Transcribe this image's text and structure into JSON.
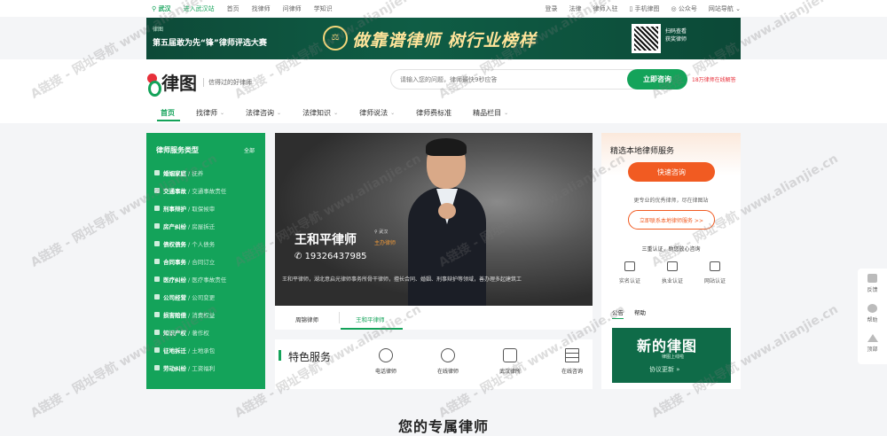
{
  "topbar": {
    "city": "武汉",
    "enter_site": "进入武汉站",
    "left_links": [
      "首页",
      "找律师",
      "问律师",
      "学知识"
    ],
    "right_links": [
      "登录",
      "法律",
      "律师入驻",
      "手机律图",
      "公众号",
      "网站导航"
    ]
  },
  "banner": {
    "brand": "律图",
    "subtitle": "第五届敢为先“锋”律师评选大赛",
    "slogan": "做靠谱律师 树行业榜样",
    "qr_text": [
      "扫码查看",
      "获奖律师"
    ]
  },
  "header": {
    "logo_name": "律图",
    "tagline": "信得过的好律师",
    "search_placeholder": "请输入您的问题，律师最快9秒应答",
    "consult_button": "立即咨询",
    "hotline": "18万律师在线解答"
  },
  "nav": {
    "items": [
      "首页",
      "找律师",
      "法律咨询",
      "法律知识",
      "律师说法",
      "律师费标准",
      "精品栏目"
    ]
  },
  "sidebar": {
    "title": "律师服务类型",
    "all_label": "全部",
    "items": [
      {
        "cat": "婚姻家庭",
        "sub": "/ 抚养"
      },
      {
        "cat": "交通事故",
        "sub": "/ 交通事故责任"
      },
      {
        "cat": "刑事辩护",
        "sub": "/ 取保候审"
      },
      {
        "cat": "房产纠纷",
        "sub": "/ 房屋拆迁"
      },
      {
        "cat": "债权债务",
        "sub": "/ 个人债务"
      },
      {
        "cat": "合同事务",
        "sub": "/ 合同订立"
      },
      {
        "cat": "医疗纠纷",
        "sub": "/ 医疗事故责任"
      },
      {
        "cat": "公司经营",
        "sub": "/ 公司变更"
      },
      {
        "cat": "损害赔偿",
        "sub": "/ 消费权益"
      },
      {
        "cat": "知识产权",
        "sub": "/ 著作权"
      },
      {
        "cat": "征地拆迁",
        "sub": "/ 土地承包"
      },
      {
        "cat": "劳动纠纷",
        "sub": "/ 工资福利"
      }
    ]
  },
  "feature": {
    "lawyer_name": "王和平律师",
    "location": "武汉",
    "role": "主办律师",
    "phone": "19326437985",
    "description": "王和平律师，湖北意启光律师事务所骨干律师，擅长合同、婚姻、刑事辩护等领域，善办理多起建筑工"
  },
  "lawyer_tabs": [
    "周锦律师",
    "王和平律师"
  ],
  "services": {
    "title": "特色服务",
    "items": [
      "电话律师",
      "在线律师",
      "武汉律所",
      "在线咨询"
    ]
  },
  "right_panel": {
    "title": "精选本地律师服务",
    "quick_button": "快速咨询",
    "note": "更专业的优秀律师，尽在律图站",
    "join_button": "立即联系本地律师服务 >>",
    "triple_check": "三重认证，助您放心咨询",
    "badges": [
      "实名认证",
      "执业认证",
      "网站认证"
    ],
    "tabs": [
      "公告",
      "帮助"
    ],
    "promo_title": "新的律图",
    "promo_sub": "律图上线啦",
    "promo_link": "协议更新 »"
  },
  "float_bar": [
    "反馈",
    "帮助",
    "顶部"
  ],
  "bottom_title": "您的专属律师",
  "watermark": "A链接 - 网址导航 www.alianjie.cn",
  "colors": {
    "brand_green": "#14a35a",
    "accent_orange": "#f15b22",
    "accent_red": "#e8303a"
  }
}
